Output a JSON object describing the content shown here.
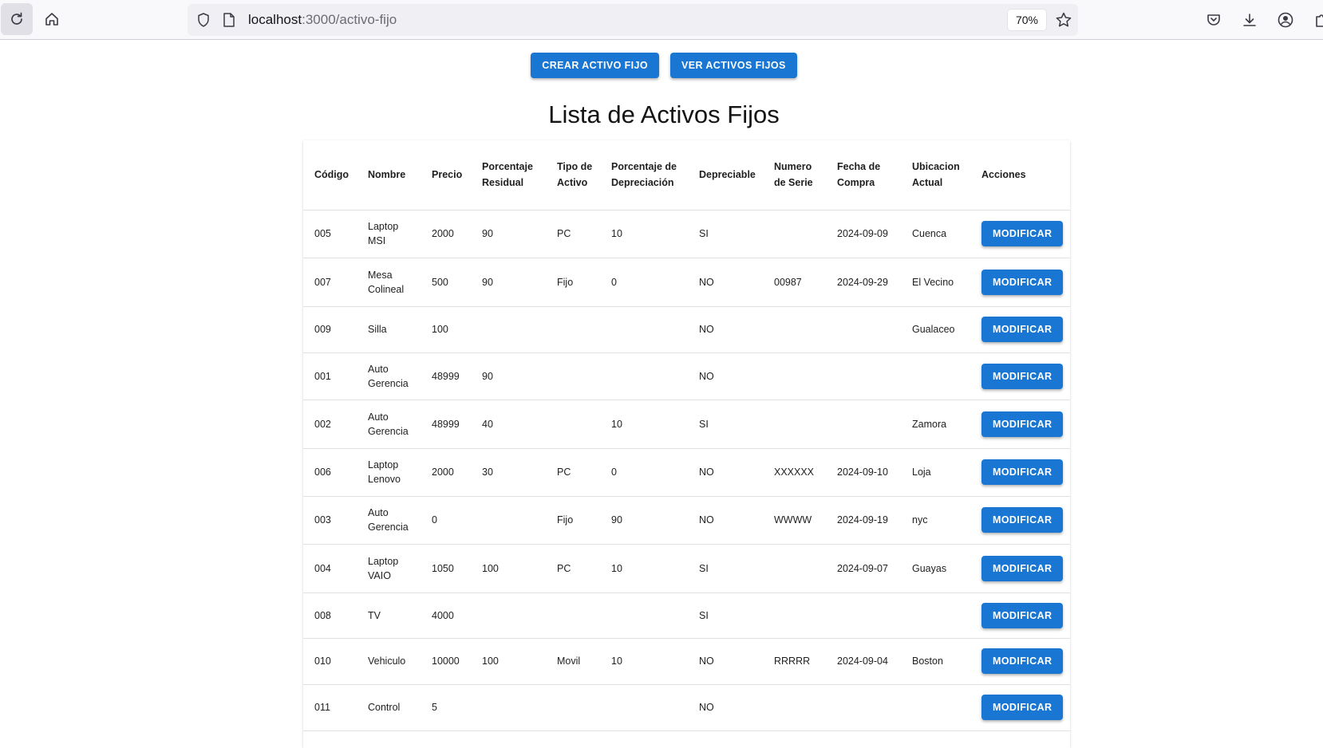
{
  "browser": {
    "url_host": "localhost",
    "url_path": ":3000/activo-fijo",
    "zoom": "70%"
  },
  "page": {
    "create_button": "CREAR ACTIVO FIJO",
    "view_button": "VER ACTIVOS FIJOS",
    "title": "Lista de Activos Fijos"
  },
  "table": {
    "headers": [
      "Código",
      "Nombre",
      "Precio",
      "Porcentaje Residual",
      "Tipo de Activo",
      "Porcentaje de Depreciación",
      "Depreciable",
      "Numero de Serie",
      "Fecha de Compra",
      "Ubicacion Actual",
      "Acciones"
    ],
    "action_label": "MODIFICAR",
    "rows": [
      [
        "005",
        "Laptop MSI",
        "2000",
        "90",
        "PC",
        "10",
        "SI",
        "",
        "2024-09-09",
        "Cuenca"
      ],
      [
        "007",
        "Mesa Colineal",
        "500",
        "90",
        "Fijo",
        "0",
        "NO",
        "00987",
        "2024-09-29",
        "El Vecino"
      ],
      [
        "009",
        "Silla",
        "100",
        "",
        "",
        "",
        "NO",
        "",
        "",
        "Gualaceo"
      ],
      [
        "001",
        "Auto Gerencia",
        "48999",
        "90",
        "",
        "",
        "NO",
        "",
        "",
        ""
      ],
      [
        "002",
        "Auto Gerencia",
        "48999",
        "40",
        "",
        "10",
        "SI",
        "",
        "",
        "Zamora"
      ],
      [
        "006",
        "Laptop Lenovo",
        "2000",
        "30",
        "PC",
        "0",
        "NO",
        "XXXXXX",
        "2024-09-10",
        "Loja"
      ],
      [
        "003",
        "Auto Gerencia",
        "0",
        "",
        "Fijo",
        "90",
        "NO",
        "WWWW",
        "2024-09-19",
        "nyc"
      ],
      [
        "004",
        "Laptop VAIO",
        "1050",
        "100",
        "PC",
        "10",
        "SI",
        "",
        "2024-09-07",
        "Guayas"
      ],
      [
        "008",
        "TV",
        "4000",
        "",
        "",
        "",
        "SI",
        "",
        "",
        ""
      ],
      [
        "010",
        "Vehiculo",
        "10000",
        "100",
        "Movil",
        "10",
        "NO",
        "RRRRR",
        "2024-09-04",
        "Boston"
      ],
      [
        "011",
        "Control",
        "5",
        "",
        "",
        "",
        "NO",
        "",
        "",
        ""
      ]
    ]
  }
}
